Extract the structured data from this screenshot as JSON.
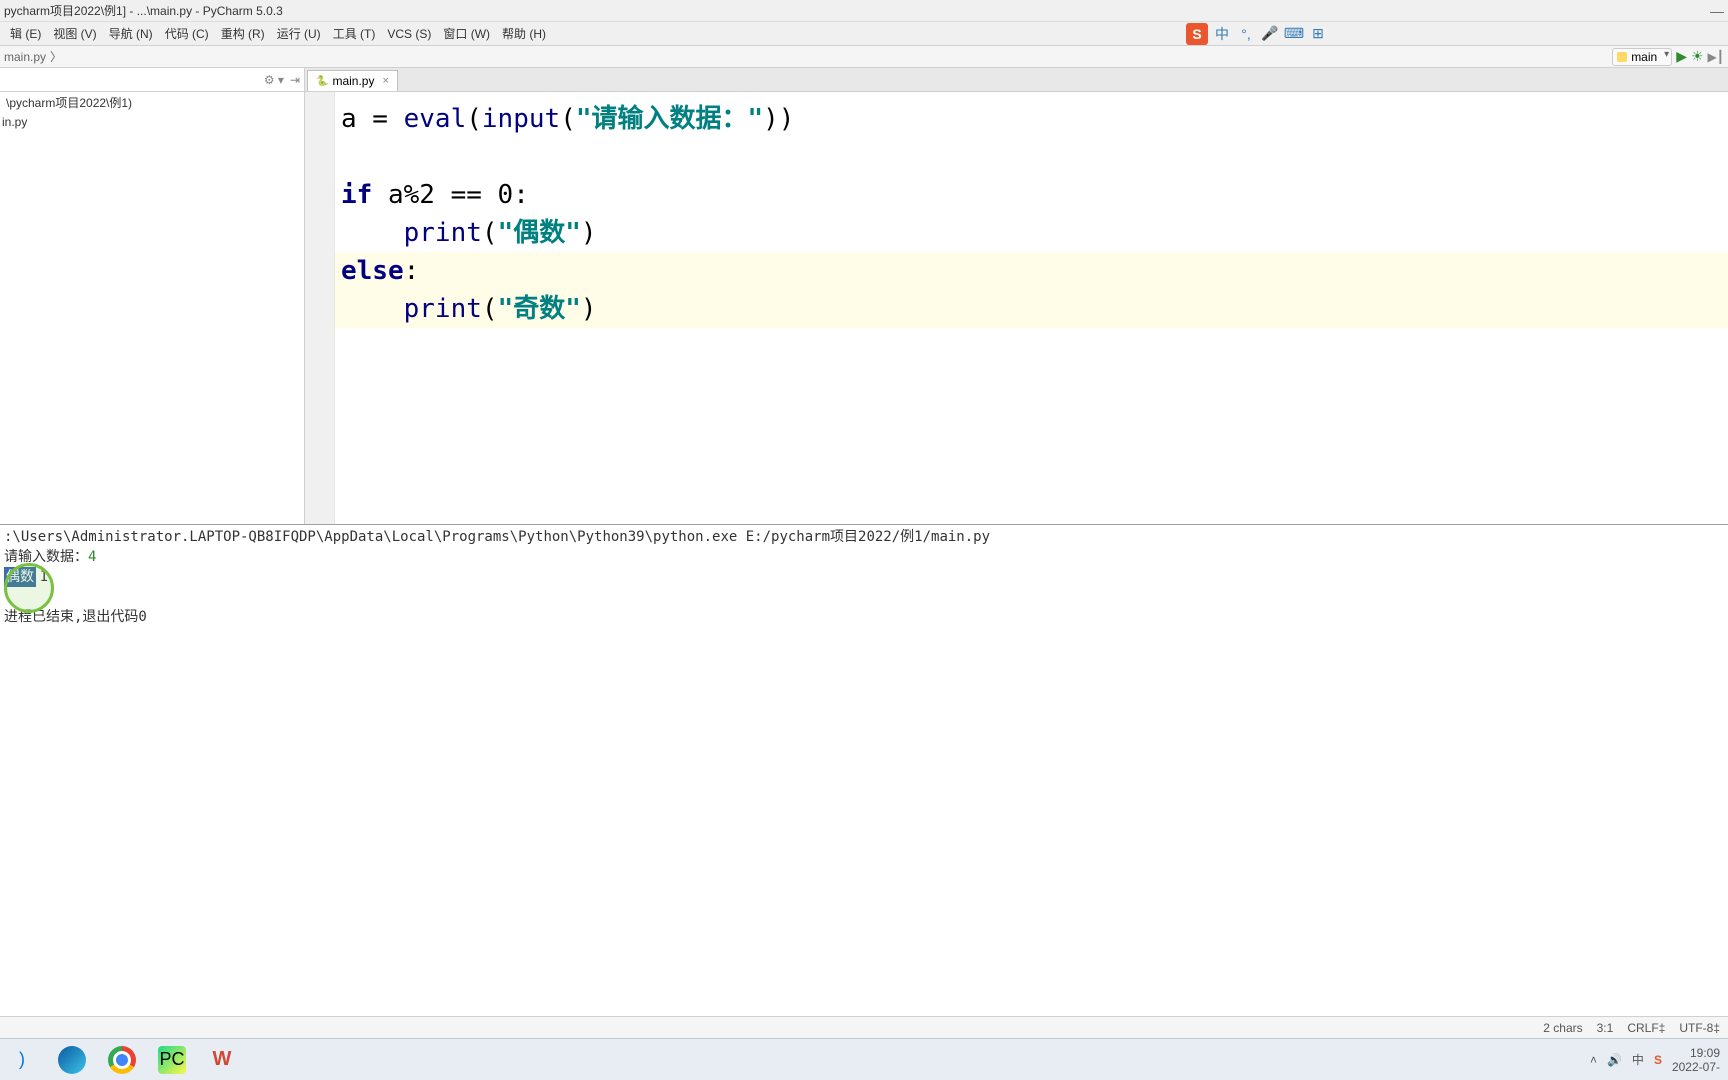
{
  "window": {
    "title": "pycharm项目2022\\例1] - ...\\main.py - PyCharm 5.0.3"
  },
  "menu": {
    "file": "辑 (E)",
    "view": "视图 (V)",
    "navigate": "导航 (N)",
    "code": "代码 (C)",
    "refactor": "重构 (R)",
    "run": "运行 (U)",
    "tools": "工具 (T)",
    "vcs": "VCS (S)",
    "window": "窗口 (W)",
    "help": "帮助 (H)"
  },
  "ime": {
    "lang": "中"
  },
  "breadcrumb": {
    "item1": "main.py"
  },
  "run_config": {
    "selected": "main"
  },
  "sidebar": {
    "root": "\\pycharm项目2022\\例1)",
    "file1": "in.py"
  },
  "tab": {
    "name": "main.py"
  },
  "code": {
    "l1_a": "a = ",
    "l1_eval": "eval",
    "l1_p1": "(",
    "l1_input": "input",
    "l1_p2": "(",
    "l1_str": "\"请输入数据：\"",
    "l1_p3": "))",
    "l3_if": "if",
    "l3_cond": " a%2 == 0:",
    "l4_indent": "    ",
    "l4_print": "print",
    "l4_p1": "(",
    "l4_str": "\"偶数\"",
    "l4_p2": ")",
    "l5_else": "else",
    "l5_colon": ":",
    "l6_indent": "    ",
    "l6_print": "print",
    "l6_p1": "(",
    "l6_str": "\"奇数\"",
    "l6_p2": ")"
  },
  "console": {
    "path": ":\\Users\\Administrator.LAPTOP-QB8IFQDP\\AppData\\Local\\Programs\\Python\\Python39\\python.exe E:/pycharm项目2022/例1/main.py",
    "prompt": "请输入数据：",
    "input_value": "4",
    "output": "偶数",
    "exit_msg": "进程已结束,退出代码0"
  },
  "status": {
    "chars": "2 chars",
    "pos": "3:1",
    "crlf": "CRLF‡",
    "encoding": "UTF-8‡"
  },
  "tray": {
    "time": "19:09",
    "date": "2022-07-"
  }
}
